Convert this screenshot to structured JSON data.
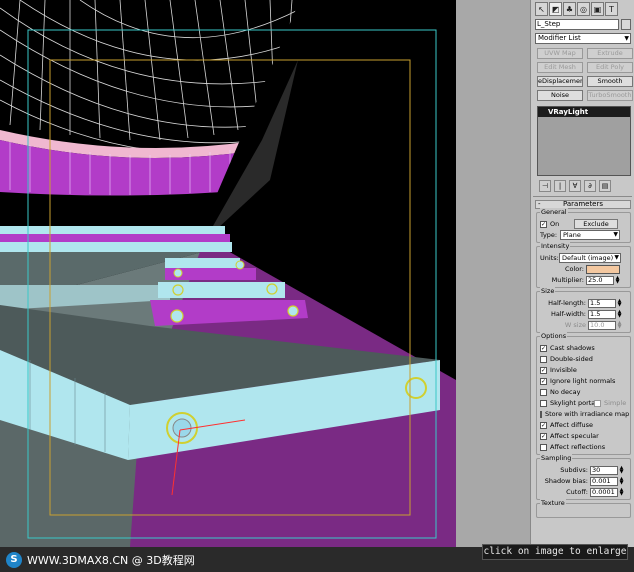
{
  "panel": {
    "tab_icons": [
      "create-icon",
      "modify-icon",
      "hierarchy-icon",
      "motion-icon",
      "display-icon",
      "utilities-icon"
    ],
    "tab_glyphs": [
      "↖",
      "◩",
      "♣",
      "◎",
      "▣",
      "T"
    ],
    "object_name": "L_Step",
    "modifier_list": "Modifier List",
    "buttons": [
      {
        "label": "UVW Map",
        "enabled": false
      },
      {
        "label": "Extrude",
        "enabled": false
      },
      {
        "label": "Edit Mesh",
        "enabled": false
      },
      {
        "label": "Edit Poly",
        "enabled": false
      },
      {
        "label": "eDisplacement",
        "enabled": true
      },
      {
        "label": "Smooth",
        "enabled": true
      },
      {
        "label": "Noise",
        "enabled": true
      },
      {
        "label": "TurboSmooth",
        "enabled": false
      }
    ],
    "stack_item": "VRayLight",
    "stack_tools": [
      "⊣",
      "|",
      "∀",
      "∂",
      "▤"
    ],
    "rollout": {
      "toggle": "-",
      "title": "Parameters",
      "general": {
        "label": "General",
        "on_label": "On",
        "on_checked": "✓",
        "exclude_label": "Exclude",
        "type_label": "Type:",
        "type_value": "Plane"
      },
      "intensity": {
        "label": "Intensity",
        "units_label": "Units:",
        "units_value": "Default (image)",
        "color_label": "Color:",
        "color_value": "#f4c8a0",
        "multiplier_label": "Multiplier:",
        "multiplier_value": "25.0"
      },
      "size": {
        "label": "Size",
        "half_length_label": "Half-length:",
        "half_length_value": "1.5",
        "half_width_label": "Half-width:",
        "half_width_value": "1.5",
        "w_size_label": "W size",
        "w_size_value": "10.0"
      },
      "options": {
        "label": "Options",
        "items": [
          {
            "label": "Cast shadows",
            "checked": "✓"
          },
          {
            "label": "Double-sided",
            "checked": ""
          },
          {
            "label": "Invisible",
            "checked": "✓"
          },
          {
            "label": "Ignore light normals",
            "checked": "✓"
          },
          {
            "label": "No decay",
            "checked": ""
          },
          {
            "label": "Skylight portal",
            "checked": "",
            "extra": "Simple"
          },
          {
            "label": "Store with irradiance map",
            "checked": ""
          },
          {
            "label": "Affect diffuse",
            "checked": "✓"
          },
          {
            "label": "Affect specular",
            "checked": "✓"
          },
          {
            "label": "Affect reflections",
            "checked": ""
          }
        ]
      },
      "sampling": {
        "label": "Sampling",
        "subdivs_label": "Subdivs:",
        "subdivs_value": "30",
        "shadow_bias_label": "Shadow bias:",
        "shadow_bias_value": "0.001",
        "cutoff_label": "Cutoff:",
        "cutoff_value": "0.0001"
      },
      "texture_label": "Texture"
    }
  },
  "watermark": {
    "logo": "S",
    "text": "WWW.3DMAX8.CN @ 3D教程网"
  },
  "enlarge_text": "click on image to enlarge",
  "colors": {
    "magenta": "#b23cc8",
    "step_face": "#b0e6ee",
    "light_color": "#f4c8a0"
  }
}
